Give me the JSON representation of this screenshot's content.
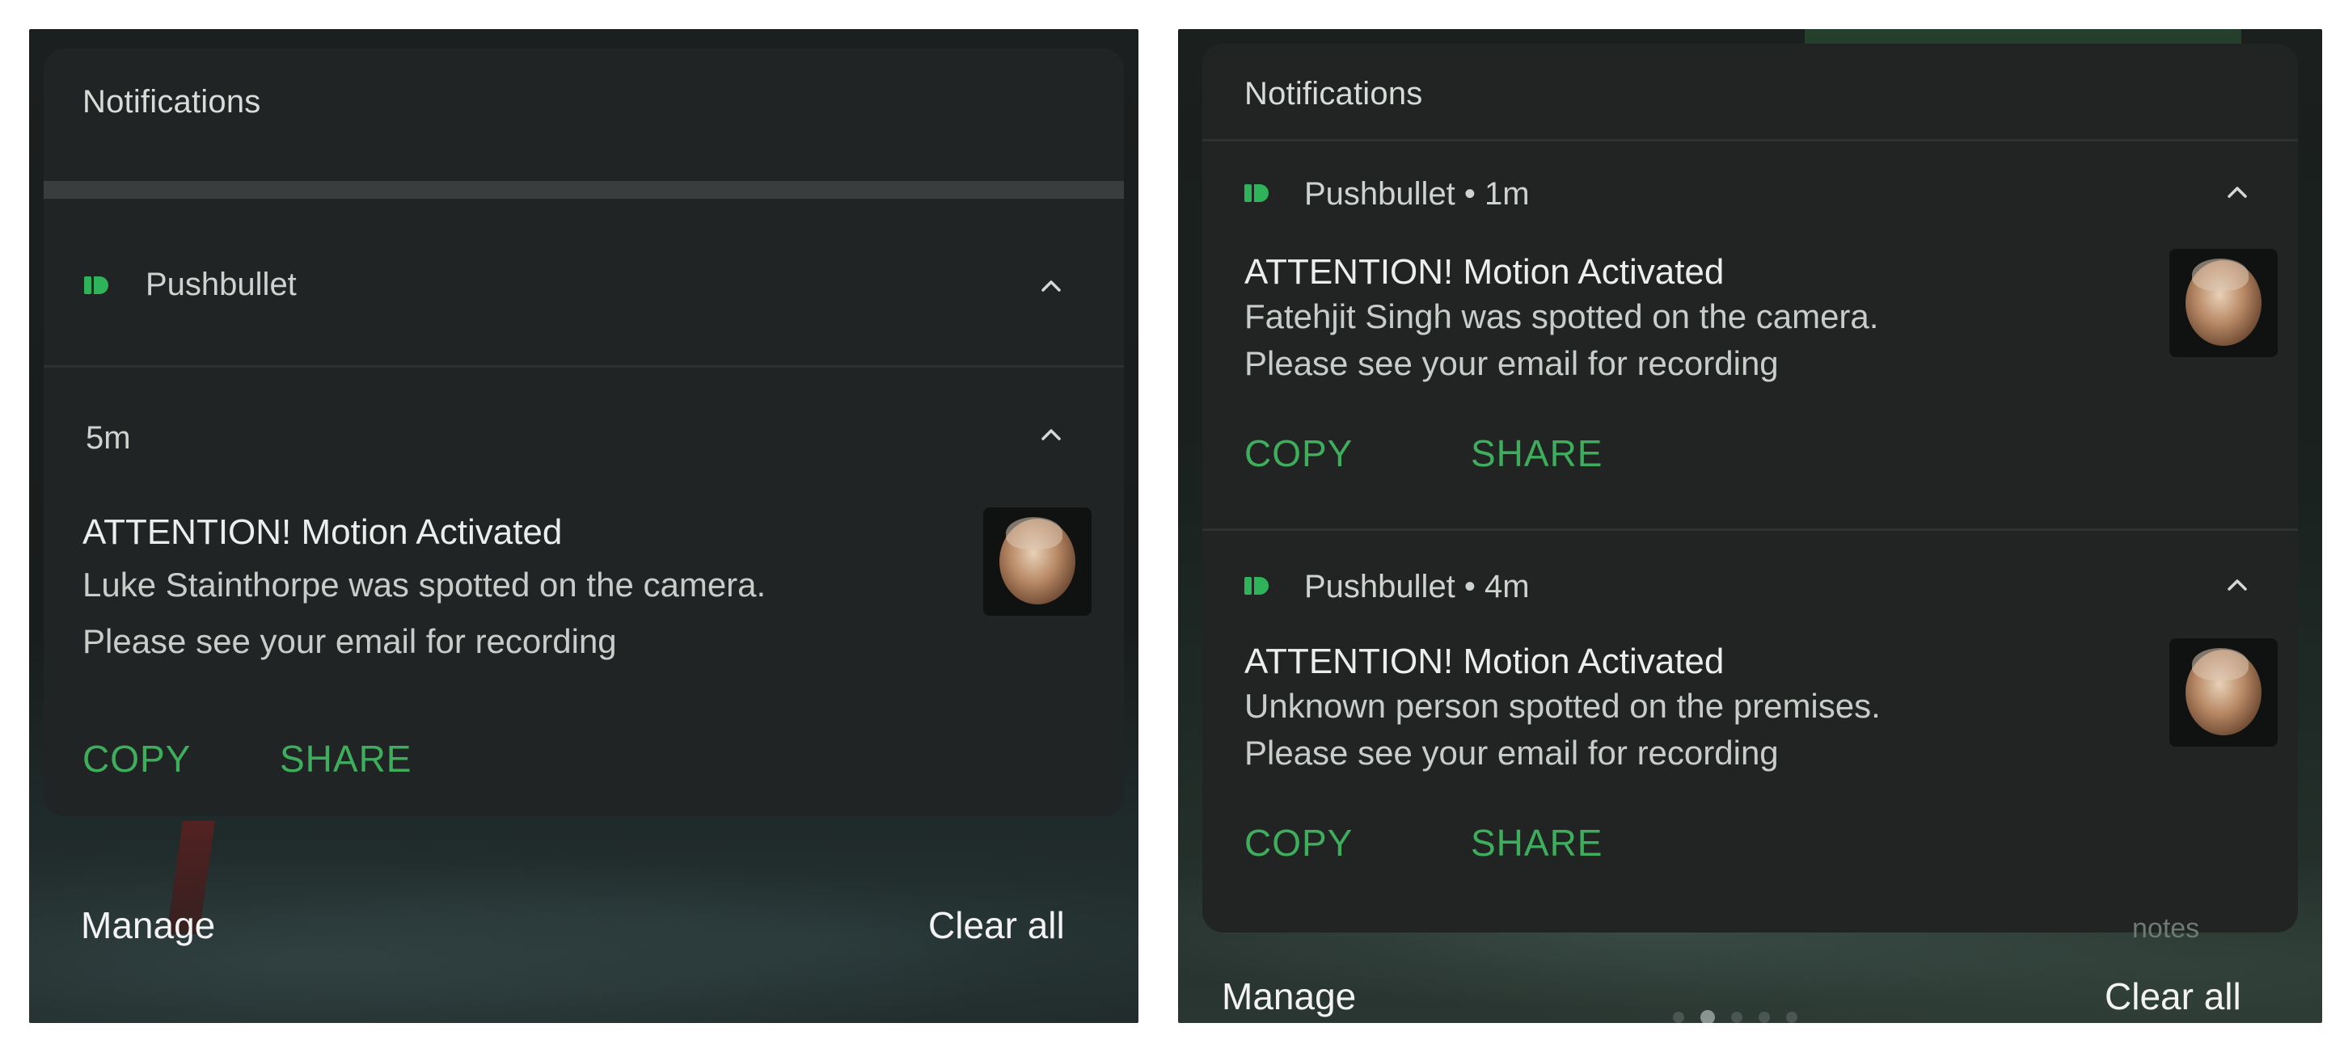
{
  "left": {
    "section_title": "Notifications",
    "app_name": "Pushbullet",
    "time": "5m",
    "notification": {
      "title": "ATTENTION! Motion Activated",
      "line1": "Luke Stainthorpe was spotted on the camera.",
      "line2": "Please see your email for recording"
    },
    "actions": {
      "copy": "COPY",
      "share": "SHARE"
    },
    "footer": {
      "manage": "Manage",
      "clear_all": "Clear all"
    }
  },
  "right": {
    "section_title": "Notifications",
    "notifications": [
      {
        "app_line": "Pushbullet • 1m",
        "title": "ATTENTION! Motion Activated",
        "line1": "Fatehjit Singh was spotted on the camera.",
        "line2": "Please see your email for recording",
        "copy": "COPY",
        "share": "SHARE"
      },
      {
        "app_line": "Pushbullet • 4m",
        "title": "ATTENTION! Motion Activated",
        "line1": "Unknown person spotted on the premises.",
        "line2": "Please see your email for recording",
        "copy": "COPY",
        "share": "SHARE"
      }
    ],
    "notes_hint": "notes",
    "footer": {
      "manage": "Manage",
      "clear_all": "Clear all"
    }
  },
  "icons": {
    "app": "pushbullet-icon",
    "expand": "chevron-up-icon",
    "avatar": "camera-snapshot-avatar"
  },
  "colors": {
    "accent_green": "#3fae5c",
    "app_icon_green": "#2fb35a",
    "card_bg": "#212424",
    "text_primary": "#eceeed"
  }
}
